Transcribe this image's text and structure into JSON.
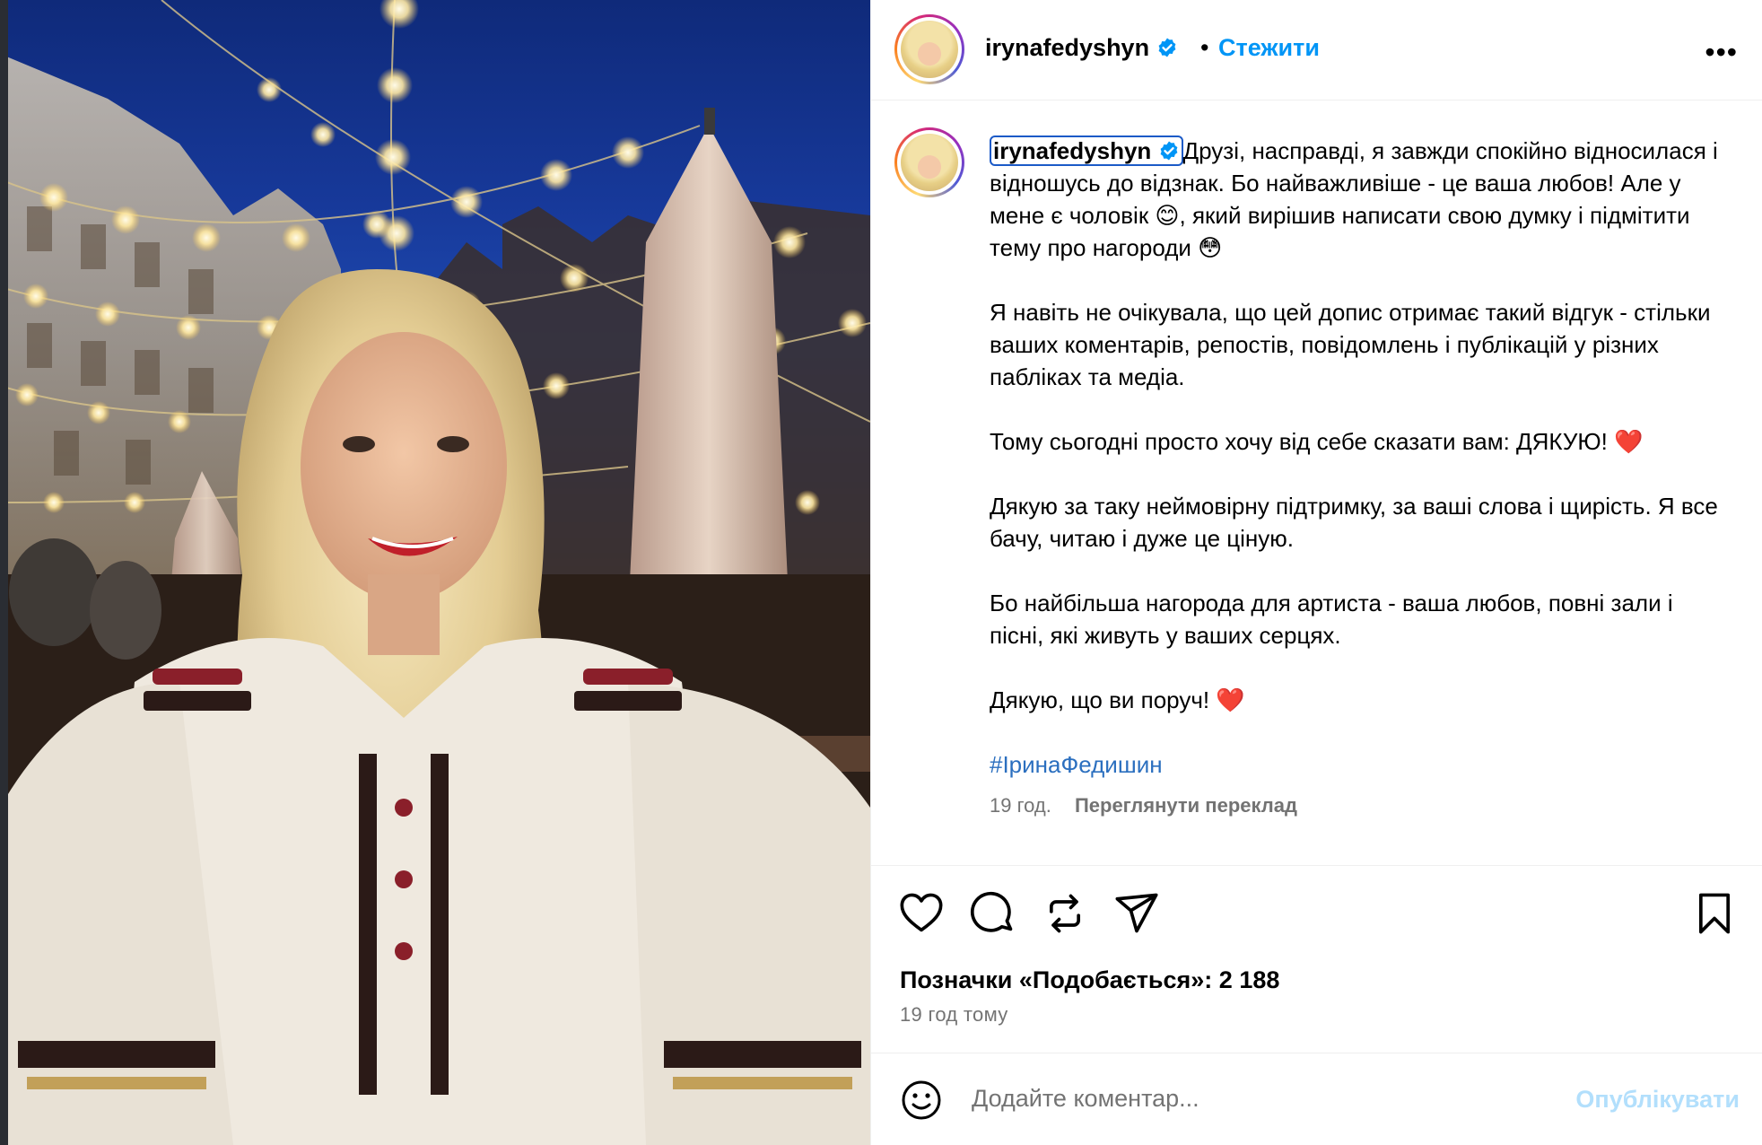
{
  "post": {
    "username": "irynafedyshyn",
    "follow_label": "Стежити",
    "separator": "•",
    "more_label": "•••"
  },
  "caption": {
    "username": "irynafedyshyn",
    "paragraphs": [
      "Друзі, насправді, я завжди спокійно відносилася і відношусь до відзнак. Бо найважливіше - це ваша любов! Але у мене є чоловік 😊, який вирішив написати свою думку і підмітити тему про нагороди 😳",
      "Я навіть не очікувала, що цей допис отримає такий відгук - стільки ваших коментарів, репостів, повідомлень і публікацій у різних пабліках та медіа.",
      "Тому сьогодні просто хочу від себе сказати вам: ДЯКУЮ! ❤️",
      "Дякую за таку неймовірну підтримку, за ваші слова і щирість. Я все бачу, читаю і дуже це ціную.",
      "Бо найбільша нагорода для артиста - ваша любов, повні зали і пісні, які живуть у ваших серцях.",
      "Дякую, що ви поруч! ❤️"
    ],
    "hashtag": "#ІринаФедишин",
    "time": "19 год.",
    "translate_label": "Переглянути переклад"
  },
  "actions": {
    "icons": [
      "heart-icon",
      "comment-icon",
      "repost-icon",
      "share-icon",
      "bookmark-icon"
    ]
  },
  "stats": {
    "likes_text": "Позначки «Подобається»: 2 188",
    "time_ago": "19 год тому"
  },
  "comment": {
    "placeholder": "Додайте коментар...",
    "publish_label": "Опублікувати"
  },
  "colors": {
    "accent": "#0095f6",
    "publish_disabled": "#b2dffc",
    "secondary_text": "#737373"
  }
}
